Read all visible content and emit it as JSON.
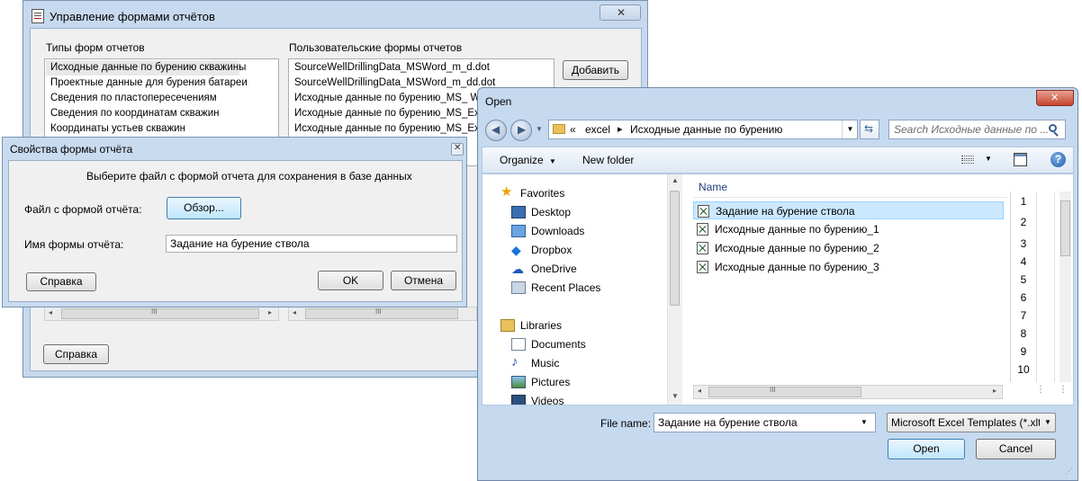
{
  "main_window": {
    "title": "Управление формами отчётов",
    "types_label": "Типы форм отчетов",
    "user_forms_label": "Пользовательские формы отчетов",
    "types": [
      "Исходные данные по бурению скважины",
      "Проектные данные для бурения батареи",
      "Сведения по пластопересечениям",
      "Сведения по координатам скважин",
      "Координаты устьев скважин"
    ],
    "user_forms": [
      "SourceWellDrillingData_MSWord_m_d.dot",
      "SourceWellDrillingData_MSWord_m_dd.dot",
      "Исходные данные по бурению_MS_ Word",
      "Исходные данные по бурению_MS_Excel",
      "Исходные данные по бурению_MS_Excel"
    ],
    "add_button": "Добавить",
    "help_button": "Справка",
    "scroll_mark": "III"
  },
  "props_dialog": {
    "title": "Свойства формы отчёта",
    "instruction": "Выберите файл с формой отчета для сохранения в базе данных",
    "file_label": "Файл с формой отчёта:",
    "browse_button": "Обзор...",
    "name_label": "Имя формы отчёта:",
    "name_value": "Задание на бурение ствола",
    "help_button": "Справка",
    "ok_button": "OK",
    "cancel_button": "Отмена"
  },
  "open_dialog": {
    "title": "Open",
    "breadcrumb": {
      "overflow": "«",
      "folder1": "excel",
      "sep": "▸",
      "folder2": "Исходные данные по бурению"
    },
    "search_placeholder": "Search Исходные данные по ...",
    "organize": "Organize",
    "new_folder": "New folder",
    "nav": {
      "favorites": "Favorites",
      "desktop": "Desktop",
      "downloads": "Downloads",
      "dropbox": "Dropbox",
      "onedrive": "OneDrive",
      "recent": "Recent Places",
      "libraries": "Libraries",
      "documents": "Documents",
      "music": "Music",
      "pictures": "Pictures",
      "videos": "Videos"
    },
    "column_name": "Name",
    "files": [
      "Задание на бурение ствола",
      "Исходные данные по бурению_1",
      "Исходные данные по бурению_2",
      "Исходные данные по бурению_3"
    ],
    "row_numbers": [
      "1",
      "2",
      "3",
      "4",
      "5",
      "6",
      "7",
      "8",
      "9",
      "10"
    ],
    "file_name_label": "File name:",
    "file_name_value": "Задание на бурение ствола",
    "file_type_value": "Microsoft Excel Templates (*.xlt",
    "open_button": "Open",
    "cancel_button": "Cancel",
    "scroll_mark": "III"
  },
  "colors": {
    "win7_frame": "#c3d6ec",
    "selection": "#cce8ff",
    "link_blue": "#1e3e7a"
  }
}
